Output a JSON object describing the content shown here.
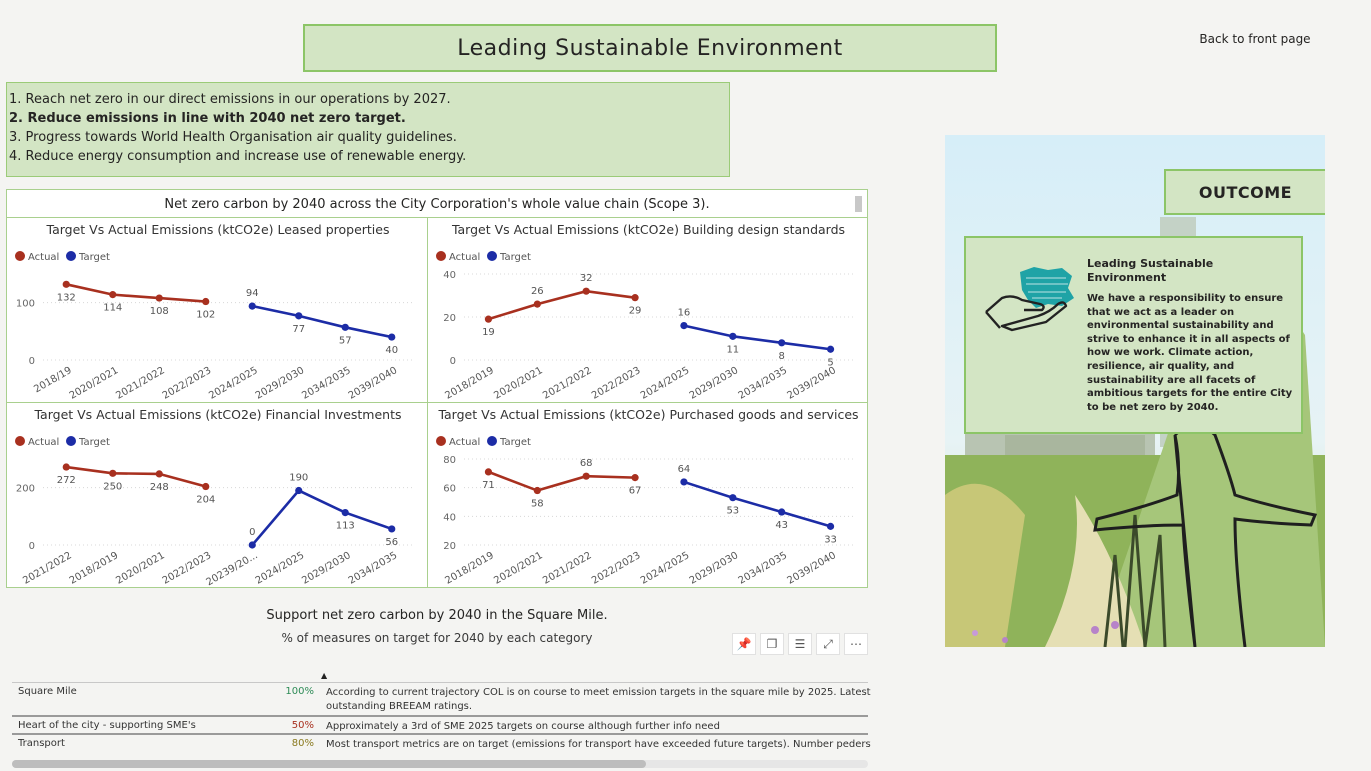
{
  "header": {
    "title": "Leading Sustainable Environment",
    "back_link": "Back to front page"
  },
  "objectives": [
    {
      "text": "1. Reach net zero in our direct emissions in our operations by 2027.",
      "bold": false
    },
    {
      "text": "2. Reduce emissions in line with 2040 net  zero target.",
      "bold": true
    },
    {
      "text": "3. Progress towards World Health Organisation air quality guidelines.",
      "bold": false
    },
    {
      "text": "4. Reduce energy consumption and increase use of renewable energy.",
      "bold": false
    }
  ],
  "chart_section": {
    "title": "Net zero carbon by 2040 across the City Corporation's whole value chain (Scope 3)."
  },
  "colors": {
    "actual": "#a8301f",
    "target": "#1c2ca6",
    "panel_green": "#d3e5c4",
    "border_green": "#8cc567"
  },
  "chart_data": [
    {
      "type": "line",
      "title": "Target Vs Actual Emissions (ktCO2e) Leased properties",
      "legend": [
        "Actual",
        "Target"
      ],
      "legend_position": "top-left",
      "categories": [
        "2018/19",
        "2020/2021",
        "2021/2022",
        "2022/2023",
        "2024/2025",
        "2029/2030",
        "2034/2035",
        "2039/2040"
      ],
      "series": [
        {
          "name": "Actual",
          "values": [
            132,
            114,
            108,
            102,
            null,
            null,
            null,
            null
          ]
        },
        {
          "name": "Target",
          "values": [
            null,
            null,
            null,
            null,
            94,
            77,
            57,
            40
          ]
        }
      ],
      "yticks": [
        0,
        100
      ],
      "ylim": [
        0,
        150
      ]
    },
    {
      "type": "line",
      "title": "Target Vs Actual Emissions (ktCO2e) Building design standards",
      "legend": [
        "Actual",
        "Target"
      ],
      "legend_position": "top-left",
      "categories": [
        "2018/2019",
        "2020/2021",
        "2021/2022",
        "2022/2023",
        "2024/2025",
        "2029/2030",
        "2034/2035",
        "2039/2040"
      ],
      "series": [
        {
          "name": "Actual",
          "values": [
            19,
            26,
            32,
            29,
            null,
            null,
            null,
            null
          ]
        },
        {
          "name": "Target",
          "values": [
            null,
            null,
            null,
            null,
            16,
            11,
            8,
            5
          ]
        }
      ],
      "yticks": [
        0,
        20,
        40
      ],
      "ylim": [
        0,
        40
      ]
    },
    {
      "type": "line",
      "title": "Target Vs Actual Emissions (ktCO2e) Financial Investments",
      "legend": [
        "Actual",
        "Target"
      ],
      "legend_position": "top-left",
      "categories": [
        "2021/2022",
        "2018/2019",
        "2020/2021",
        "2022/2023",
        "20239/20...",
        "2024/2025",
        "2029/2030",
        "2034/2035"
      ],
      "series": [
        {
          "name": "Actual",
          "values": [
            272,
            250,
            248,
            204,
            null,
            null,
            null,
            null
          ]
        },
        {
          "name": "Target",
          "values": [
            null,
            null,
            null,
            null,
            0,
            190,
            113,
            56
          ]
        }
      ],
      "yticks": [
        0,
        200
      ],
      "ylim": [
        0,
        300
      ]
    },
    {
      "type": "line",
      "title": "Target Vs Actual Emissions (ktCO2e) Purchased goods and services",
      "legend": [
        "Actual",
        "Target"
      ],
      "legend_position": "top-left",
      "categories": [
        "2018/2019",
        "2020/2021",
        "2021/2022",
        "2022/2023",
        "2024/2025",
        "2029/2030",
        "2034/2035",
        "2039/2040"
      ],
      "series": [
        {
          "name": "Actual",
          "values": [
            71,
            58,
            68,
            67,
            null,
            null,
            null,
            null
          ]
        },
        {
          "name": "Target",
          "values": [
            null,
            null,
            null,
            null,
            64,
            53,
            43,
            33
          ]
        }
      ],
      "yticks": [
        20,
        40,
        60,
        80
      ],
      "ylim": [
        20,
        80
      ]
    }
  ],
  "square_mile": {
    "title": "Support net zero carbon by 2040 in the Square Mile.",
    "subtitle": "% of measures on target for 2040 by each category",
    "toolbar": {
      "pin": "📌",
      "copy": "❐",
      "filter": "☰",
      "focus": "⤢",
      "more": "⋯"
    },
    "rows": [
      {
        "category": "Square Mile",
        "percent": "100%",
        "percent_color": "#2e8b57",
        "description": "According to current trajectory COL is on course to meet emission targets in the square mile by 2025. Latest",
        "description2": "outstanding BREEAM ratings."
      },
      {
        "category": "Heart of the city - supporting SME's",
        "percent": "50%",
        "percent_color": "#a8301f",
        "description": "Approximately a 3rd of SME 2025 targets on course although further info need",
        "description2": ""
      },
      {
        "category": "Transport",
        "percent": "80%",
        "percent_color": "#8a7a1f",
        "description": "Most transport metrics are on target (emissions for transport have exceeded future targets). Number pederst",
        "description2": ""
      }
    ]
  },
  "outcome": {
    "label": "OUTCOME",
    "card_title": "Leading Sustainable Environment",
    "card_text": "We have a responsibility to ensure that we act as a leader on environmental sustainability and strive to enhance it in all aspects of how we work. Climate action, resilience, air quality, and sustainability are all facets of ambitious targets for the entire City to be net zero by 2040.",
    "icon": "hand-holding-city-icon"
  }
}
